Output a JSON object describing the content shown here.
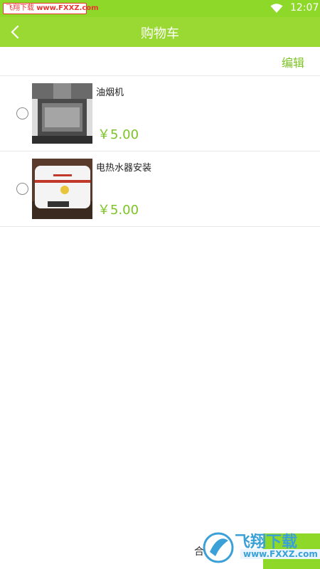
{
  "status_bar": {
    "watermark_brand": "飞翔下载",
    "watermark_url": "www.FXXZ.com",
    "time": "12:07"
  },
  "header": {
    "title": "购物车"
  },
  "toolbar": {
    "edit_label": "编辑"
  },
  "cart": {
    "items": [
      {
        "name": "油烟机",
        "price": "￥5.00",
        "image": "range-hood-image",
        "selected": false
      },
      {
        "name": "电热水器安装",
        "price": "￥5.00",
        "image": "water-heater-image",
        "selected": false
      }
    ]
  },
  "footer": {
    "total_label": "合"
  },
  "watermark": {
    "text": "飞翔下载",
    "url": "www.FXXZ.com"
  },
  "colors": {
    "accent": "#8ed82a",
    "price": "#7cc424"
  }
}
